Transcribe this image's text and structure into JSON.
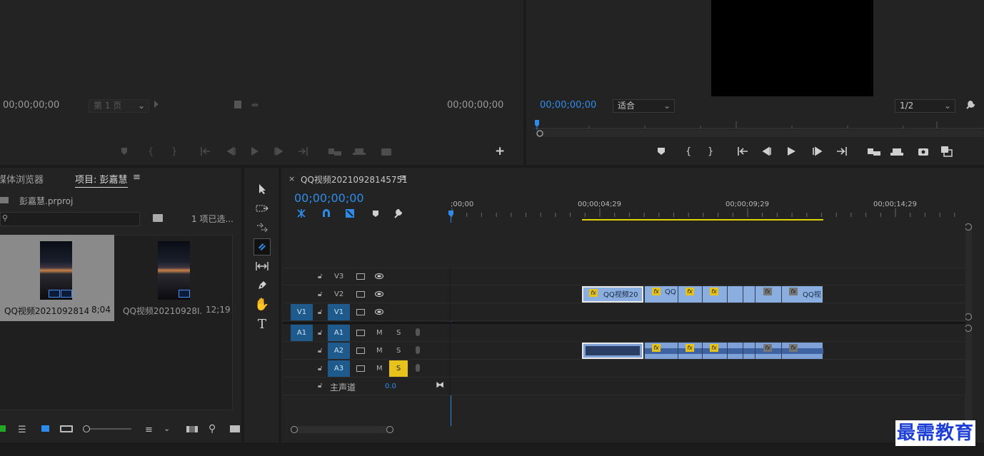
{
  "source_monitor": {
    "timecode_left": "00;00;00;00",
    "page_select": "第 1 页",
    "timecode_right": "00;00;00;00"
  },
  "program_monitor": {
    "timecode": "00;00;00;00",
    "fit_select": "适合",
    "resolution_select": "1/2"
  },
  "project_panel": {
    "tab_media_browser": "媒体浏览器",
    "tab_project": "项目: 彭嘉慧",
    "project_file": "彭嘉慧.prproj",
    "selection_count": "1 项已选...",
    "items": [
      {
        "name": "QQ视频2021092814...",
        "duration": "8;04"
      },
      {
        "name": "QQ视频20210928I...",
        "duration": "12;19"
      }
    ]
  },
  "timeline": {
    "close": "×",
    "sequence_name": "QQ视频20210928145751",
    "timecode": "00;00;00;00",
    "ruler": [
      ";00;00",
      "00;00;04;29",
      "00;00;09;29",
      "00;00;14;29"
    ],
    "tracks": {
      "v3": "V3",
      "v2": "V2",
      "v1": "V1",
      "v1_src": "V1",
      "a1": "A1",
      "a1_src": "A1",
      "a2": "A2",
      "a3": "A3",
      "m": "M",
      "s": "S"
    },
    "master_label": "主声道",
    "master_value": "0.0",
    "clip_v2_first": "QQ视频20",
    "clip_v2_second": "QQ",
    "clip_v2_last": "QQ视",
    "fx_label": "fx"
  },
  "watermark": "最需教育",
  "colors": {
    "accent_blue": "#2d8ceb",
    "clip_video": "#8aaee0",
    "clip_audio": "#7ea2d8",
    "track_target": "#1e5b8c",
    "solo_active": "#e7c21a",
    "work_area": "#e0d400"
  }
}
